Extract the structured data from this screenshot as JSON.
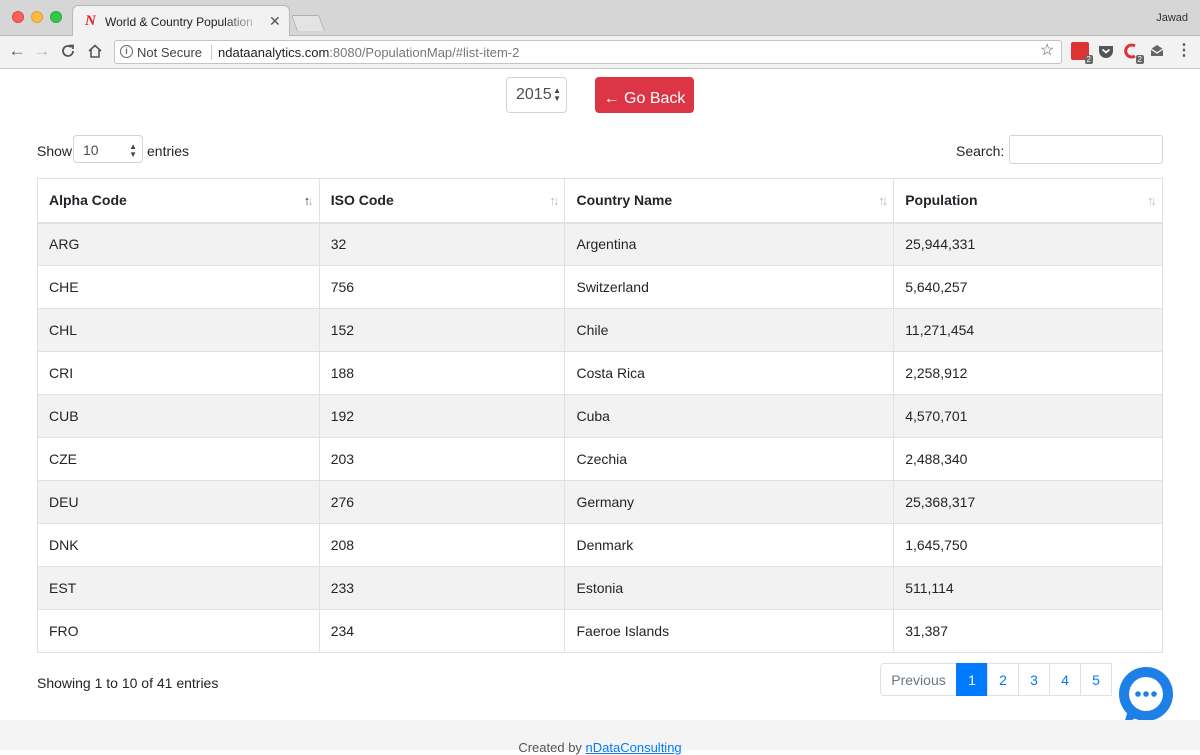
{
  "browser": {
    "tab_title": "World & Country Population Map",
    "tab_favicon": "N",
    "tab_close": "✕",
    "profile_name": "Jawad",
    "security_label": "Not Secure",
    "url_host": "ndataanalytics.com",
    "url_path": ":8080/PopulationMap/#list-item-2",
    "ext_badge_1": "2",
    "ext_badge_2": "2"
  },
  "controls": {
    "year": "2015",
    "go_back_label": "← Go Back"
  },
  "table_controls": {
    "show_label": "Show",
    "page_length": "10",
    "entries_label": "entries",
    "search_label": "Search:"
  },
  "table": {
    "columns": [
      "Alpha Code",
      "ISO Code",
      "Country Name",
      "Population"
    ],
    "rows": [
      [
        "ARG",
        "32",
        "Argentina",
        "25,944,331"
      ],
      [
        "CHE",
        "756",
        "Switzerland",
        "5,640,257"
      ],
      [
        "CHL",
        "152",
        "Chile",
        "11,271,454"
      ],
      [
        "CRI",
        "188",
        "Costa Rica",
        "2,258,912"
      ],
      [
        "CUB",
        "192",
        "Cuba",
        "4,570,701"
      ],
      [
        "CZE",
        "203",
        "Czechia",
        "2,488,340"
      ],
      [
        "DEU",
        "276",
        "Germany",
        "25,368,317"
      ],
      [
        "DNK",
        "208",
        "Denmark",
        "1,645,750"
      ],
      [
        "EST",
        "233",
        "Estonia",
        "511,114"
      ],
      [
        "FRO",
        "234",
        "Faeroe Islands",
        "31,387"
      ]
    ]
  },
  "pagination": {
    "info": "Showing 1 to 10 of 41 entries",
    "previous_label": "Previous",
    "pages": [
      "1",
      "2",
      "3",
      "4",
      "5"
    ],
    "active_page": "1"
  },
  "footer": {
    "prefix": "Created by ",
    "link": "nDataConsulting"
  },
  "colors": {
    "go_back": "#dc3545",
    "pager_active": "#007bff",
    "chat_bubble": "#1e7fe6"
  }
}
